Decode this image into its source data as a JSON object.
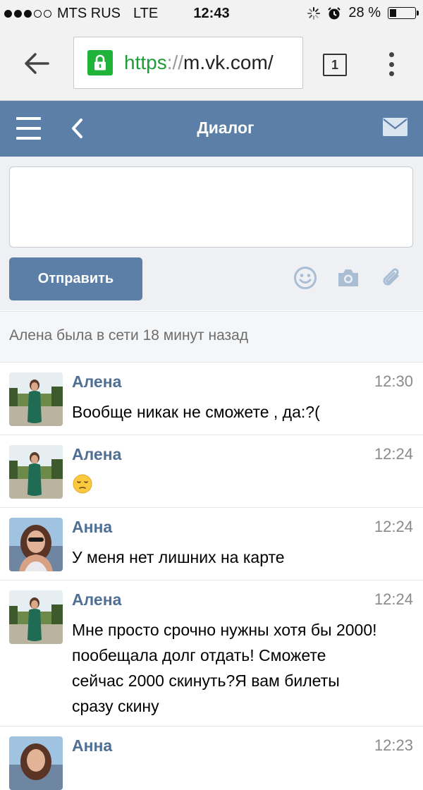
{
  "status_bar": {
    "carrier": "MTS RUS",
    "network": "LTE",
    "time": "12:43",
    "battery_percent": "28 %",
    "battery_level": 0.28,
    "signal_bars_filled": 3,
    "signal_bars_total": 5
  },
  "browser": {
    "url_scheme": "https",
    "url_separator": "://",
    "url_host": "m.vk.com/",
    "tab_count": "1"
  },
  "vk_header": {
    "title": "Диалог"
  },
  "composer": {
    "input_value": "",
    "send_label": "Отправить"
  },
  "last_seen": "Алена была в сети 18 минут назад",
  "messages": [
    {
      "name": "Алена",
      "time": "12:30",
      "text": "Вообще никак не сможете , да:?("
    },
    {
      "name": "Алена",
      "time": "12:24",
      "text": ""
    },
    {
      "name": "Анна",
      "time": "12:24",
      "text": "У меня нет лишних на карте"
    },
    {
      "name": "Алена",
      "time": "12:24",
      "text": "Мне просто срочно нужны хотя бы 2000! пообещала долг отдать! Сможете сейчас 2000 скинуть?Я вам билеты сразу скину"
    },
    {
      "name": "Анна",
      "time": "12:23",
      "text": ""
    }
  ],
  "colors": {
    "vk_blue": "#5b7fa6",
    "name_blue": "#4f6f94",
    "secure_green": "#1fb33a"
  }
}
